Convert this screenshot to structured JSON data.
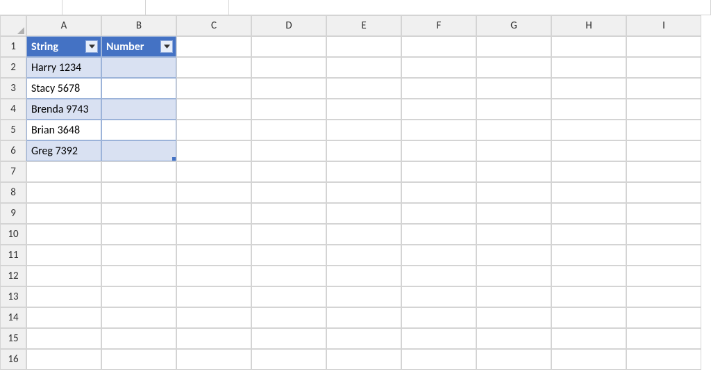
{
  "columns": [
    "A",
    "B",
    "C",
    "D",
    "E",
    "F",
    "G",
    "H",
    "I"
  ],
  "rows": [
    "1",
    "2",
    "3",
    "4",
    "5",
    "6",
    "7",
    "8",
    "9",
    "10",
    "11",
    "12",
    "13",
    "14",
    "15",
    "16"
  ],
  "table": {
    "headers": [
      "String",
      "Number"
    ],
    "data": [
      [
        "Harry 1234",
        ""
      ],
      [
        "Stacy 5678",
        ""
      ],
      [
        "Brenda 9743",
        ""
      ],
      [
        "Brian 3648",
        ""
      ],
      [
        "Greg 7392",
        ""
      ]
    ]
  },
  "colors": {
    "tableHeader": "#4472c4",
    "tableBandEven": "#d9e1f2",
    "tableBandOdd": "#ffffff"
  }
}
